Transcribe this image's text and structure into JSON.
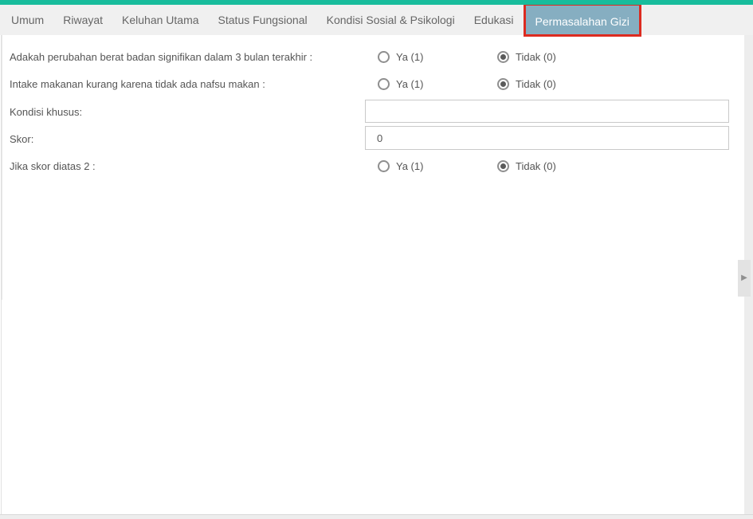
{
  "colors": {
    "topbar_accent": "#18bc9c",
    "tabbar_bg": "#f0f0f0",
    "active_tab_bg": "#86aec1",
    "annotation_highlight_red": "#dc2b20"
  },
  "tabs": {
    "items": [
      {
        "label": "Umum",
        "active": false
      },
      {
        "label": "Riwayat",
        "active": false
      },
      {
        "label": "Keluhan Utama",
        "active": false
      },
      {
        "label": "Status Fungsional",
        "active": false
      },
      {
        "label": "Kondisi Sosial & Psikologi",
        "active": false
      },
      {
        "label": "Edukasi",
        "active": false
      },
      {
        "label": "Permasalahan Gizi",
        "active": true
      }
    ]
  },
  "form": {
    "rows": [
      {
        "label": "Adakah perubahan berat badan signifikan dalam 3 bulan terakhir :",
        "type": "radio",
        "options": [
          {
            "label": "Ya (1)",
            "selected": false
          },
          {
            "label": "Tidak (0)",
            "selected": true
          }
        ]
      },
      {
        "label": "Intake makanan kurang karena tidak ada nafsu makan :",
        "type": "radio",
        "options": [
          {
            "label": "Ya (1)",
            "selected": false
          },
          {
            "label": "Tidak (0)",
            "selected": true
          }
        ]
      },
      {
        "label": "Kondisi khusus:",
        "type": "text",
        "value": "",
        "placeholder": ""
      },
      {
        "label": "Skor:",
        "type": "text",
        "value": "0",
        "placeholder": ""
      },
      {
        "label": "Jika skor diatas 2 :",
        "type": "radio",
        "options": [
          {
            "label": "Ya (1)",
            "selected": false
          },
          {
            "label": "Tidak (0)",
            "selected": true
          }
        ]
      }
    ]
  },
  "side_panel": {
    "expand_icon": "chevron-right"
  }
}
